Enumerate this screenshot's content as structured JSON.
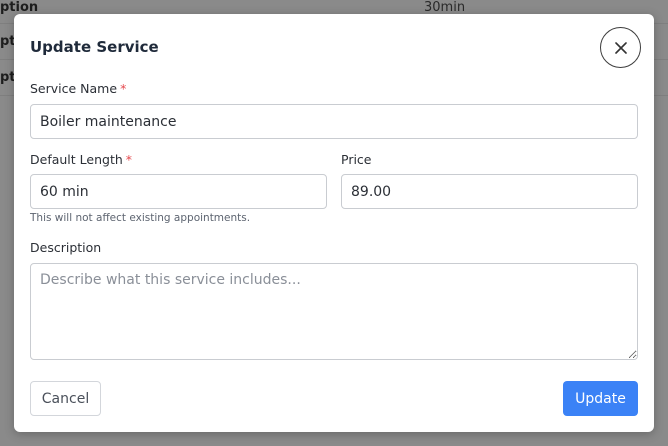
{
  "background": {
    "rows": [
      {
        "left_text": "ption",
        "right_text": "30min"
      },
      {
        "left_text": "ptio",
        "right_text": ""
      },
      {
        "left_text": "ptio",
        "right_text": ""
      }
    ]
  },
  "modal": {
    "title": "Update Service",
    "close_icon": "close-icon",
    "service_name": {
      "label": "Service Name",
      "required_mark": "*",
      "value": "Boiler maintenance"
    },
    "default_length": {
      "label": "Default Length",
      "required_mark": "*",
      "value": "60 min",
      "hint": "This will not affect existing appointments."
    },
    "price": {
      "label": "Price",
      "value": "89.00"
    },
    "description": {
      "label": "Description",
      "placeholder": "Describe what this service includes..."
    },
    "cancel_label": "Cancel",
    "update_label": "Update"
  },
  "colors": {
    "accent": "#3b82f6",
    "required": "#e5484d",
    "overlay": "#8a8a8a"
  }
}
